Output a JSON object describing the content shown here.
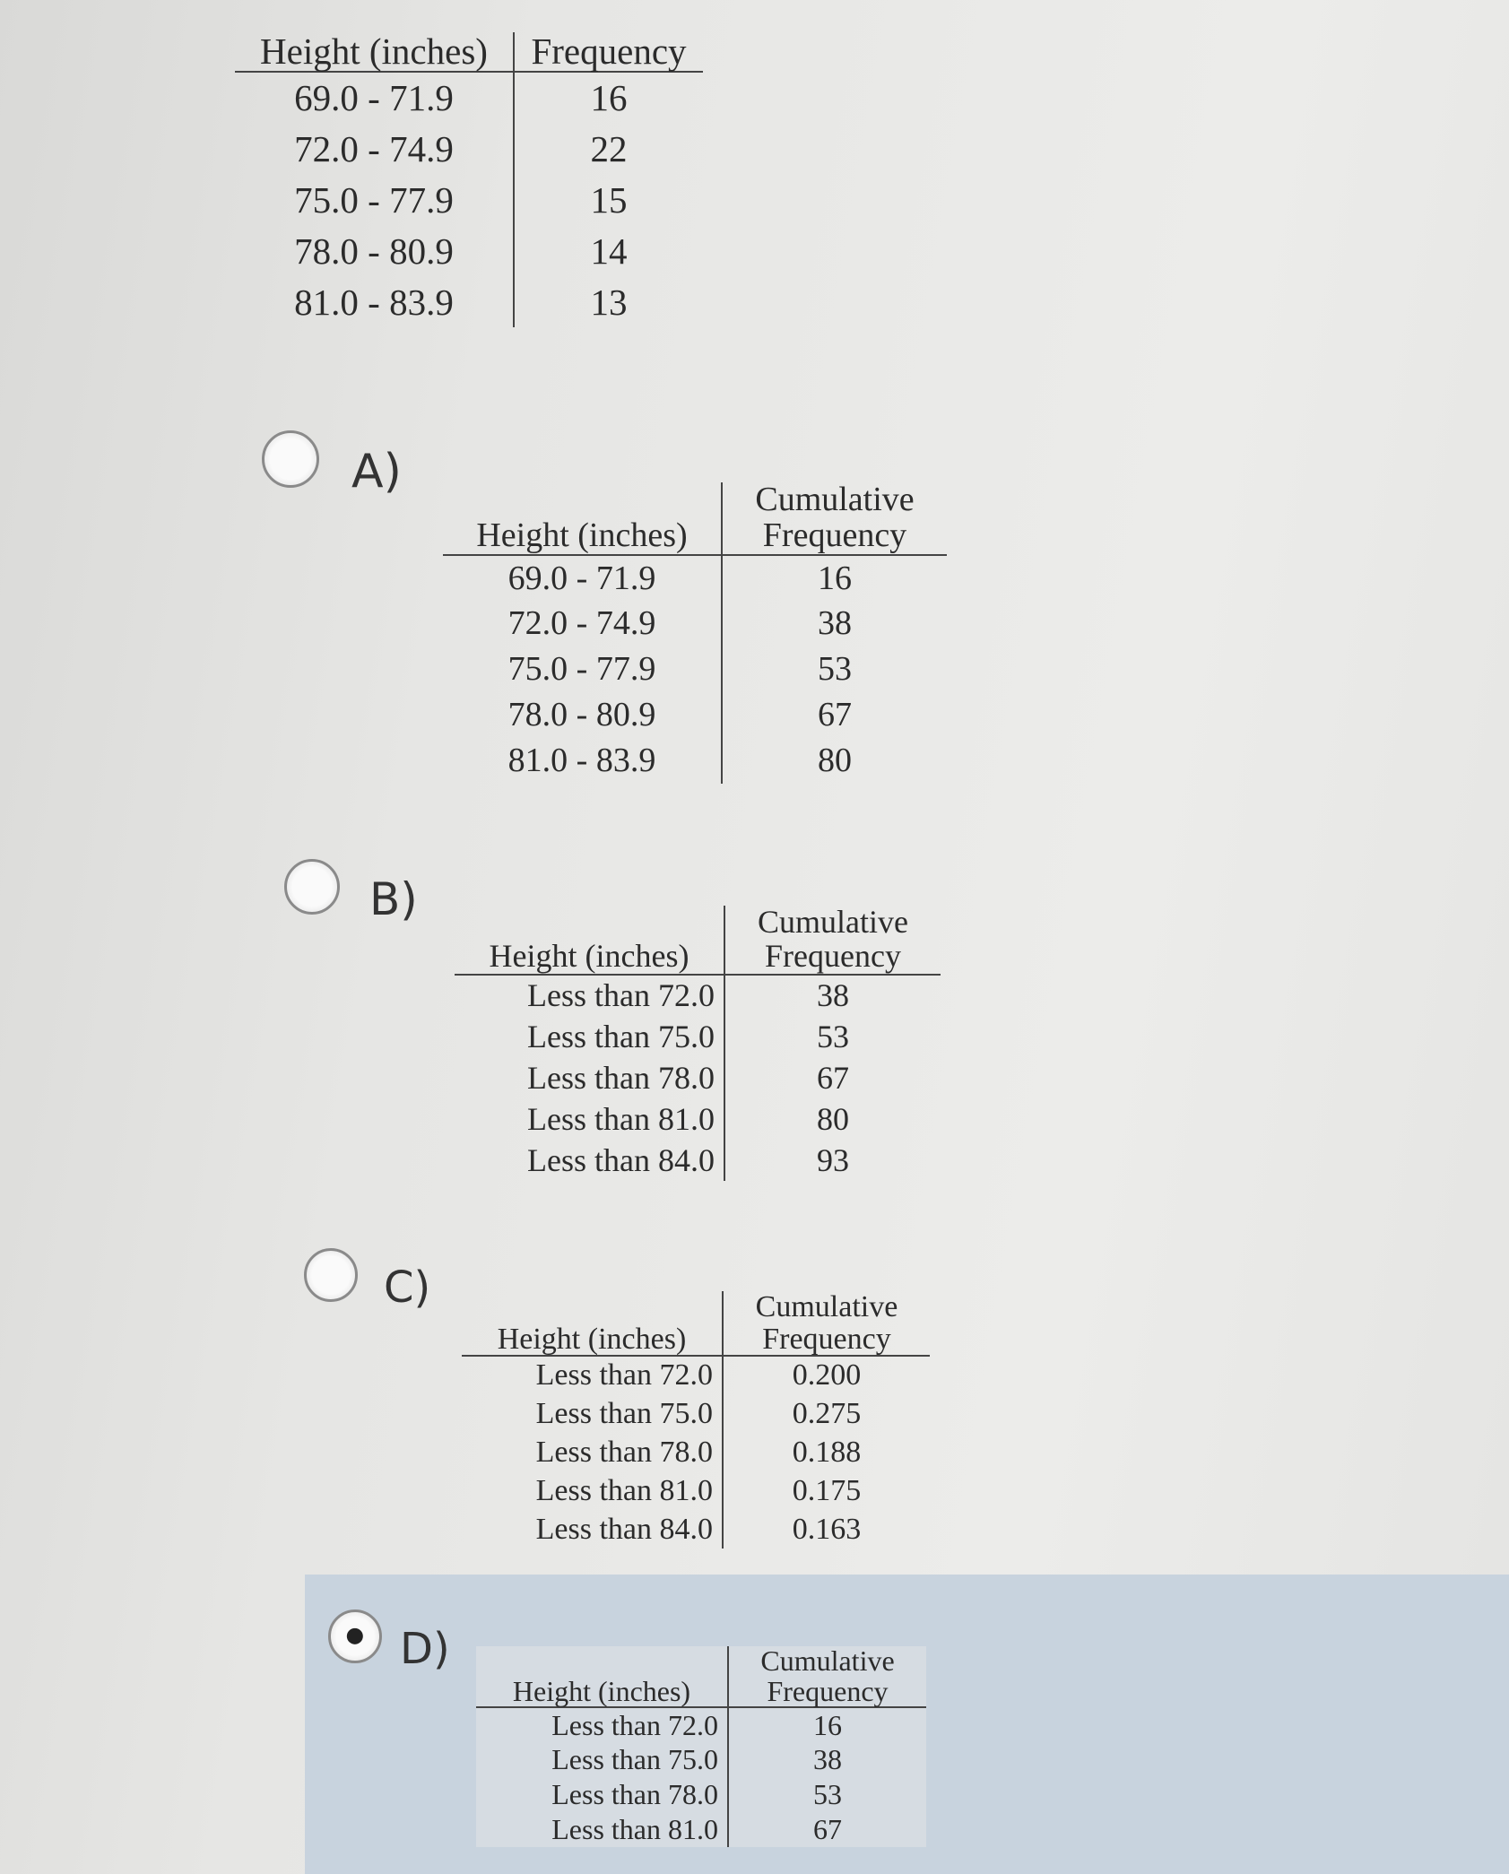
{
  "question_table": {
    "headers": [
      "Height (inches)",
      "Frequency"
    ],
    "rows": [
      [
        "69.0 - 71.9",
        "16"
      ],
      [
        "72.0 - 74.9",
        "22"
      ],
      [
        "75.0 - 77.9",
        "15"
      ],
      [
        "78.0 - 80.9",
        "14"
      ],
      [
        "81.0 - 83.9",
        "13"
      ]
    ]
  },
  "options": [
    {
      "label": "A)",
      "selected": false,
      "headers": [
        "Height (inches)",
        "Cumulative",
        "Frequency"
      ],
      "rows": [
        [
          "69.0 - 71.9",
          "16"
        ],
        [
          "72.0 - 74.9",
          "38"
        ],
        [
          "75.0 - 77.9",
          "53"
        ],
        [
          "78.0 - 80.9",
          "67"
        ],
        [
          "81.0 - 83.9",
          "80"
        ]
      ]
    },
    {
      "label": "B)",
      "selected": false,
      "headers": [
        "Height (inches)",
        "Cumulative",
        "Frequency"
      ],
      "rows": [
        [
          "Less than 72.0",
          "38"
        ],
        [
          "Less than 75.0",
          "53"
        ],
        [
          "Less than 78.0",
          "67"
        ],
        [
          "Less than 81.0",
          "80"
        ],
        [
          "Less than 84.0",
          "93"
        ]
      ]
    },
    {
      "label": "C)",
      "selected": false,
      "headers": [
        "Height (inches)",
        "Cumulative",
        "Frequency"
      ],
      "rows": [
        [
          "Less than 72.0",
          "0.200"
        ],
        [
          "Less than 75.0",
          "0.275"
        ],
        [
          "Less than 78.0",
          "0.188"
        ],
        [
          "Less than 81.0",
          "0.175"
        ],
        [
          "Less than 84.0",
          "0.163"
        ]
      ]
    },
    {
      "label": "D)",
      "selected": true,
      "headers": [
        "Height (inches)",
        "Cumulative",
        "Frequency"
      ],
      "rows": [
        [
          "Less than 72.0",
          "16"
        ],
        [
          "Less than 75.0",
          "38"
        ],
        [
          "Less than 78.0",
          "53"
        ],
        [
          "Less than 81.0",
          "67"
        ]
      ]
    }
  ],
  "colors": {
    "selected_highlight": "#c8d3de",
    "text": "#2b2b2b"
  }
}
